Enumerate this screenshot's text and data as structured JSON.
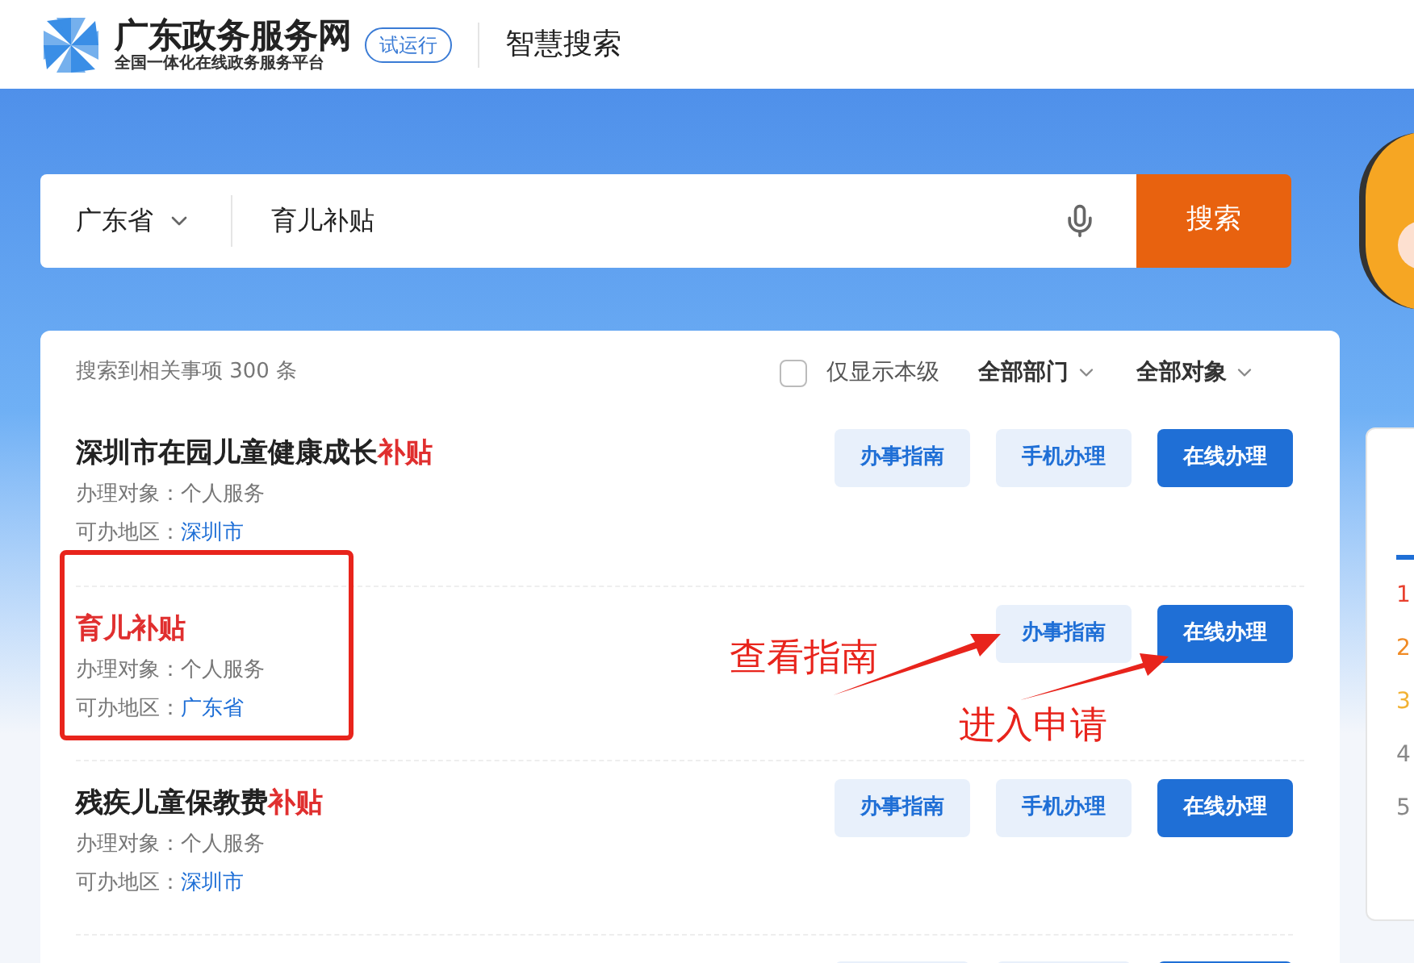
{
  "header": {
    "site_name": "广东政务服务网",
    "site_subtitle": "全国一体化在线政务服务平台",
    "badge": "试运行",
    "section": "智慧搜索"
  },
  "search": {
    "region": "广东省",
    "value": "育儿补贴",
    "button": "搜索"
  },
  "filters": {
    "result_count": "搜索到相关事项 300 条",
    "local_only": {
      "label": "仅显示本级",
      "checked": false
    },
    "dropdowns": [
      "全部部门",
      "全部对象"
    ]
  },
  "results": [
    {
      "title_parts": [
        {
          "text": "深圳市在园儿童健康成长",
          "highlight": false
        },
        {
          "text": "补贴",
          "highlight": true
        }
      ],
      "target_label": "办理对象：",
      "target": "个人服务",
      "area_label": "可办地区：",
      "area": "深圳市",
      "buttons": [
        {
          "label": "办事指南",
          "kind": "secondary"
        },
        {
          "label": "手机办理",
          "kind": "secondary"
        },
        {
          "label": "在线办理",
          "kind": "primary"
        }
      ]
    },
    {
      "title_parts": [
        {
          "text": "育儿补贴",
          "highlight": true
        }
      ],
      "target_label": "办理对象：",
      "target": "个人服务",
      "area_label": "可办地区：",
      "area": "广东省",
      "buttons": [
        {
          "label": "办事指南",
          "kind": "secondary"
        },
        {
          "label": "在线办理",
          "kind": "primary"
        }
      ]
    },
    {
      "title_parts": [
        {
          "text": "残疾儿童保教费",
          "highlight": false
        },
        {
          "text": "补贴",
          "highlight": true
        }
      ],
      "target_label": "办理对象：",
      "target": "个人服务",
      "area_label": "可办地区：",
      "area": "深圳市",
      "buttons": [
        {
          "label": "办事指南",
          "kind": "secondary"
        },
        {
          "label": "手机办理",
          "kind": "secondary"
        },
        {
          "label": "在线办理",
          "kind": "primary"
        }
      ]
    }
  ],
  "side_panel": {
    "ranks": [
      {
        "label": "1",
        "color": "#e8402e"
      },
      {
        "label": "2",
        "color": "#f08a24"
      },
      {
        "label": "3",
        "color": "#f2b233"
      },
      {
        "label": "4",
        "color": "#888888"
      },
      {
        "label": "5",
        "color": "#888888"
      }
    ]
  },
  "annotations": {
    "guide_note": "查看指南",
    "apply_note": "进入申请"
  }
}
